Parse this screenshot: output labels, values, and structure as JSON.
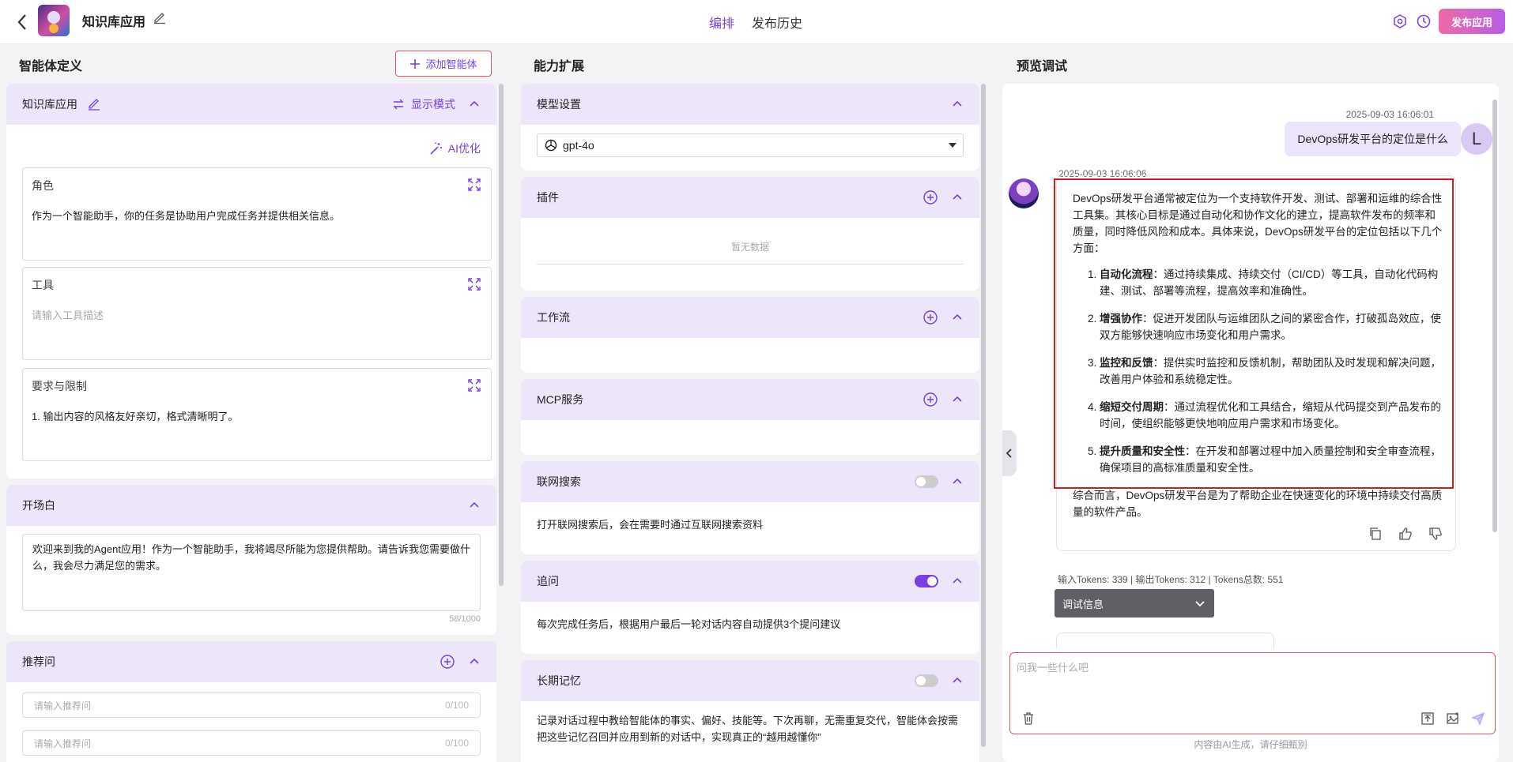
{
  "header": {
    "app_name": "知识库应用",
    "tabs": [
      {
        "label": "编排",
        "active": true
      },
      {
        "label": "发布历史",
        "active": false
      }
    ],
    "publish_label": "发布应用",
    "accent": "#7a3fe0"
  },
  "left": {
    "title": "智能体定义",
    "add_agent_label": "添加智能体",
    "agent_panel": {
      "name": "知识库应用",
      "display_mode_label": "显示模式",
      "ai_optimize_label": "AI优化",
      "role": {
        "title": "角色",
        "value": "作为一个智能助手，你的任务是协助用户完成任务并提供相关信息。"
      },
      "tools": {
        "title": "工具",
        "placeholder": "请输入工具描述"
      },
      "limits": {
        "title": "要求与限制",
        "value": "1. 输出内容的风格友好亲切，格式清晰明了。"
      }
    },
    "opening": {
      "title": "开场白",
      "value": "欢迎来到我的Agent应用！作为一个智能助手，我将竭尽所能为您提供帮助。请告诉我您需要做什么，我会尽力满足您的需求。",
      "count": "58/1000"
    },
    "recommend": {
      "title": "推荐问",
      "inputs": [
        {
          "placeholder": "请输入推荐问",
          "count": "0/100"
        },
        {
          "placeholder": "请输入推荐问",
          "count": "0/100"
        }
      ]
    }
  },
  "middle": {
    "title": "能力扩展",
    "model": {
      "title": "模型设置",
      "selected": "gpt-4o"
    },
    "plugin": {
      "title": "插件",
      "empty": "暂无数据"
    },
    "workflow": {
      "title": "工作流"
    },
    "mcp": {
      "title": "MCP服务"
    },
    "web_search": {
      "title": "联网搜索",
      "enabled": false,
      "desc": "打开联网搜索后，会在需要时通过互联网搜索资料"
    },
    "follow_up": {
      "title": "追问",
      "enabled": true,
      "desc": "每次完成任务后，根据用户最后一轮对话内容自动提供3个提问建议"
    },
    "memory": {
      "title": "长期记忆",
      "enabled": false,
      "desc": "记录对话过程中教给智能体的事实、偏好、技能等。下次再聊，无需重复交代，智能体会按需把这些记忆召回并应用到新的对话中，实现真正的“越用越懂你”"
    }
  },
  "right": {
    "title": "预览调试",
    "user_message": {
      "time": "2025-09-03 16:06:01",
      "text": "DevOps研发平台的定位是什么",
      "avatar": "L"
    },
    "bot_message": {
      "time": "2025-09-03 16:06:06",
      "intro": "DevOps研发平台通常被定位为一个支持软件开发、测试、部署和运维的综合性工具集。其核心目标是通过自动化和协作文化的建立，提高软件发布的频率和质量，同时降低风险和成本。具体来说，DevOps研发平台的定位包括以下几个方面：",
      "items": [
        {
          "head": "自动化流程",
          "text": "：通过持续集成、持续交付（CI/CD）等工具，自动化代码构建、测试、部署等流程，提高效率和准确性。"
        },
        {
          "head": "增强协作",
          "text": "：促进开发团队与运维团队之间的紧密合作，打破孤岛效应，使双方能够快速响应市场变化和用户需求。"
        },
        {
          "head": "监控和反馈",
          "text": "：提供实时监控和反馈机制，帮助团队及时发现和解决问题，改善用户体验和系统稳定性。"
        },
        {
          "head": "缩短交付周期",
          "text": "：通过流程优化和工具结合，缩短从代码提交到产品发布的时间，使组织能够更快地响应用户需求和市场变化。"
        },
        {
          "head": "提升质量和安全性",
          "text": "：在开发和部署过程中加入质量控制和安全审查流程，确保项目的高标准质量和安全性。"
        }
      ],
      "summary": "综合而言，DevOps研发平台是为了帮助企业在快速变化的环境中持续交付高质量的软件产品。"
    },
    "tokens": "输入Tokens: 339 | 输出Tokens: 312 | Tokens总数: 551",
    "debug_label": "调试信息",
    "input_placeholder": "问我一些什么吧",
    "disclaimer": "内容由AI生成，请仔细甄别"
  }
}
